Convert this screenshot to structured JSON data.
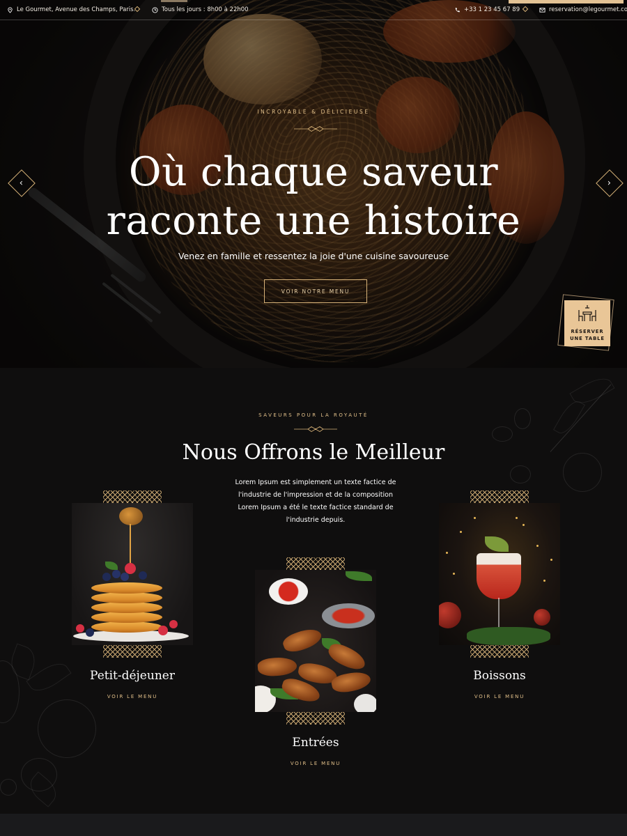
{
  "topbar": {
    "address": "Le Gourmet, Avenue des Champs, Paris.",
    "hours": "Tous les jours : 8h00 à 22h00",
    "phone": "+33 1 23 45 67 89",
    "email": "reservation@legourmet.com"
  },
  "hero": {
    "eyebrow": "INCROYABLE & DÉLICIEUSE",
    "title_line1": "Où chaque saveur",
    "title_line2": "raconte une histoire",
    "subtitle": "Venez en famille et ressentez la joie d'une cuisine savoureuse",
    "cta_label": "VOIR NOTRE MENU",
    "prev_icon": "chevron-left-icon",
    "next_icon": "chevron-right-icon"
  },
  "reserve": {
    "line1": "RÉSERVER",
    "line2": "UNE TABLE",
    "icon": "dining-table-icon"
  },
  "offer": {
    "eyebrow": "SAVEURS POUR LA ROYAUTÉ",
    "title": "Nous Offrons le Meilleur",
    "description": "Lorem Ipsum est simplement un texte factice de l'industrie de l'impression et de la composition Lorem Ipsum a été le texte factice standard de l'industrie depuis.",
    "cards": [
      {
        "name": "Petit-déjeuner",
        "link": "VOIR LE MENU"
      },
      {
        "name": "Entrées",
        "link": "VOIR LE MENU"
      },
      {
        "name": "Boissons",
        "link": "VOIR LE MENU"
      }
    ]
  },
  "colors": {
    "accent_gold": "#e2c08a",
    "reserve_bg": "#e9c697",
    "section_bg": "#0f0e0e"
  }
}
